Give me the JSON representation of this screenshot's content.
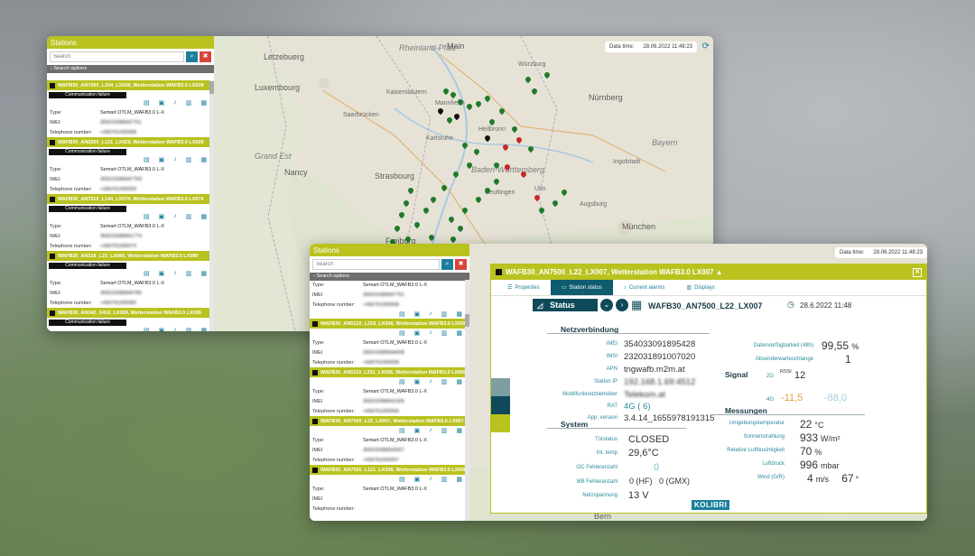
{
  "colors": {
    "accent": "#b9c21f",
    "teal": "#1b7f9c",
    "dark_teal": "#0f5b70",
    "failure": "#111111"
  },
  "back_window": {
    "stations_title": "Stations",
    "search_placeholder": "Search",
    "search_options": "Search options",
    "datetime_label": "Data time:",
    "datetime_value": "28.06.2022 11:48:23",
    "items": [
      {
        "title": "WAFB30_AN7500_L104_LX028, Wetterstation WAFB3.0 LX028",
        "failure": "Communication failure",
        "type": "Semart OTLM_WAFB3.0 L-X",
        "imei": "355015086847751",
        "phone": "+436761000008"
      },
      {
        "title": "WAFB30_AN5200_L121_LX029, Wetterstation WAFB3.0 LX029",
        "failure": "Communication failure",
        "type": "Semart OTLM_WAFB3.0 L-X",
        "imei": "355015086847769",
        "phone": "+436761000009"
      },
      {
        "title": "WAFB30_AN7510_L144_LX074, Wetterstation WAFB3.0 LX074",
        "failure": "Communication failure",
        "type": "Semart OTLM_WAFB3.0 L-X",
        "imei": "355015086841774",
        "phone": "+436761000074"
      },
      {
        "title": "WAFB30_AN318_L23_LX080, Wetterstation WAFB3.0 LX080",
        "failure": "Communication failure",
        "type": "Semart OTLM_WAFB3.0 L-X",
        "imei": "355015086849780",
        "phone": "+436761000080"
      },
      {
        "title": "WAFB30_AN342_X410_LX099, Wetterstation WAFB3.0 LX099",
        "failure": "Communication failure",
        "type": "",
        "imei": "",
        "phone": ""
      }
    ],
    "map_labels": [
      "Rheinland-Pfalz",
      "Main",
      "Letzebuerg",
      "Luxembourg",
      "Würzburg",
      "Kaiserslautern",
      "Mannheim",
      "Saarbrücken",
      "Nürnberg",
      "Heilbronn",
      "Karlsruhe",
      "Grand Est",
      "Bayern",
      "Nancy",
      "Baden-Württemberg",
      "Ingolstadt",
      "Strasbourg",
      "Reutlingen",
      "Ulm",
      "Augsburg",
      "München",
      "Freiburg"
    ]
  },
  "front_window": {
    "stations_title": "Stations",
    "search_placeholder": "Search",
    "search_options": "Search options",
    "datetime_label": "Data time:",
    "datetime_value": "28.06.2022 11:48:23",
    "first": {
      "type": "Semart OTLM_WAFB3.0 L-X",
      "imei": "355015086847751",
      "phone": "+436761000008"
    },
    "items": [
      {
        "title": "WAFB30_AN5120_L218_LX008, Wetterstation WAFB3.0 LX008",
        "type": "Semart OTLM_WAFB3.0 L-X",
        "imei": "355015086844008",
        "phone": "+436761000008"
      },
      {
        "title": "WAFB30_AN5110_L331_LX006, Wetterstation WAFB3.0 LX006",
        "type": "Semart OTLM_WAFB3.0 L-X",
        "imei": "355015086841006",
        "phone": "+436761000006"
      },
      {
        "title": "WAFB30_AN7500_L22_LX007, Wetterstation WAFB3.0 LX007",
        "type": "Semart OTLM_WAFB3.0 L-X",
        "imei": "355015086843007",
        "phone": "+436761000007"
      },
      {
        "title": "WAFB30_AN7500_L121_LX008, Wetterstation WAFB3.0 LX008",
        "type": "Semart OTLM_WAFB3.0 L-X",
        "imei": "",
        "phone": ""
      }
    ],
    "labels": {
      "type": "Type:",
      "imei": "IMEI",
      "phone": "Telephone number:"
    },
    "map_label": "Bern"
  },
  "status_dialog": {
    "title": "WAFB30_AN7500_L22_LX007, Wetterstation WAFB3.0 LX007",
    "tabs": [
      "Properties",
      "Station status",
      "Current alarms",
      "Displays"
    ],
    "status_label": "Status",
    "station_name": "WAFB30_AN7500_L22_LX007",
    "date": "28.6.2022 11:48",
    "sections": {
      "network": "Netzverbindung",
      "system": "System",
      "signal": "Signal",
      "measurements": "Messungen"
    },
    "network": [
      {
        "label": "IMEI",
        "value": "354033091895428"
      },
      {
        "label": "IMSI",
        "value": "232031891007020"
      },
      {
        "label": "APN",
        "value": "tngwafb.m2m.at"
      },
      {
        "label": "Station IP",
        "value": "192.168.1.69:4512"
      },
      {
        "label": "Mobilfunknetzbetreiber",
        "value": "Telekom.at"
      },
      {
        "label": "RAT",
        "value": "4G ( 6)"
      },
      {
        "label": "App. version",
        "value": "3.4.14_1655978191315"
      }
    ],
    "availability": {
      "label": "Datenverfügbarkeit (48h)",
      "value": "99,55",
      "unit": "%"
    },
    "absender": {
      "label": "Absenderwarteschlange",
      "value": "1"
    },
    "signal": {
      "label_2g": "2G",
      "rssi_label": "RSSI",
      "rssi": "12",
      "label_4g": "4G",
      "v1": "-11,5",
      "v2": "-88,0"
    },
    "system": [
      {
        "label": "Türstatus",
        "value": "CLOSED"
      },
      {
        "label": "Int. temp",
        "value": "29,6°C"
      },
      {
        "label": "I2C Fehleranzahl",
        "value": "0"
      },
      {
        "label": "MB Fehleranzahl",
        "value": "0 (HF)   0 (GMX)"
      },
      {
        "label": "Netzspannung",
        "value": "13 V"
      }
    ],
    "measurements": [
      {
        "label": "Umgebungstemperatur",
        "value": "22",
        "unit": "°C"
      },
      {
        "label": "Sonnenstrahlung",
        "value": "933",
        "unit": "W/m²"
      },
      {
        "label": "Relative Luftfeuchtigkeit",
        "value": "70",
        "unit": "%"
      },
      {
        "label": "Luftdruck",
        "value": "996",
        "unit": "mbar"
      },
      {
        "label": "Wind (G/R)",
        "value": "4",
        "unit": "m/s",
        "dir": "67",
        "dir_unit": "°"
      }
    ],
    "logo": "KOLIBRI"
  }
}
